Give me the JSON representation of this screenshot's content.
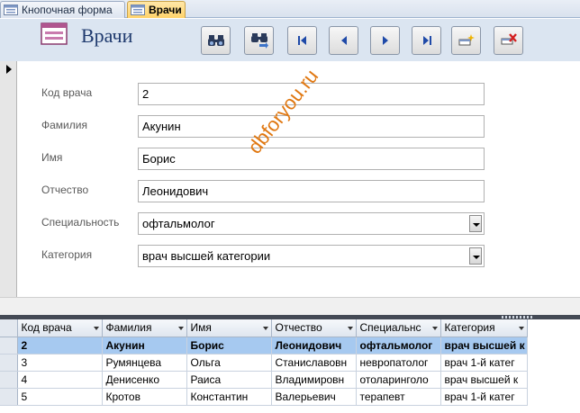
{
  "tabs": [
    {
      "label": "Кнопочная форма",
      "icon": "form-icon",
      "active": false
    },
    {
      "label": "Врачи",
      "icon": "form-icon",
      "active": true
    }
  ],
  "header": {
    "title": "Врачи",
    "logo_icon": "form-logo-icon",
    "buttons": [
      {
        "name": "find-button",
        "icon": "binoculars-icon"
      },
      {
        "name": "find-next-button",
        "icon": "binoculars-next-icon"
      },
      {
        "name": "first-record-button",
        "icon": "first-record-icon"
      },
      {
        "name": "prev-record-button",
        "icon": "prev-record-icon"
      },
      {
        "name": "next-record-button",
        "icon": "next-record-icon"
      },
      {
        "name": "last-record-button",
        "icon": "last-record-icon"
      },
      {
        "name": "new-record-button",
        "icon": "new-record-icon"
      },
      {
        "name": "delete-record-button",
        "icon": "delete-record-icon"
      }
    ]
  },
  "form": {
    "fields": [
      {
        "label": "Код врача",
        "value": "2",
        "type": "text"
      },
      {
        "label": "Фамилия",
        "value": "Акунин",
        "type": "text"
      },
      {
        "label": "Имя",
        "value": "Борис",
        "type": "text"
      },
      {
        "label": "Отчество",
        "value": "Леонидович",
        "type": "text"
      },
      {
        "label": "Специальность",
        "value": "офтальмолог",
        "type": "combo"
      },
      {
        "label": "Категория",
        "value": "врач высшей категории",
        "type": "combo"
      }
    ],
    "watermark": "dbforyou.ru"
  },
  "datasheet": {
    "columns": [
      "Код врача",
      "Фамилия",
      "Имя",
      "Отчество",
      "Специальнс",
      "Категория"
    ],
    "rows": [
      [
        "2",
        "Акунин",
        "Борис",
        "Леонидович",
        "офтальмолог",
        "врач высшей к"
      ],
      [
        "3",
        "Румянцева",
        "Ольга",
        "Станиславовн",
        "невропатолог",
        "врач 1-й катег"
      ],
      [
        "4",
        "Денисенко",
        "Раиса",
        "Владимировн",
        "отоларинголо",
        "врач высшей к"
      ],
      [
        "5",
        "Кротов",
        "Константин",
        "Валерьевич",
        "терапевт",
        "врач 1-й катег"
      ]
    ],
    "selected_row": 0
  },
  "colors": {
    "header_bg": "#dbe5f1",
    "active_tab": "#ffd36a",
    "selected_row": "#a6c9f0",
    "watermark": "#e07812"
  }
}
